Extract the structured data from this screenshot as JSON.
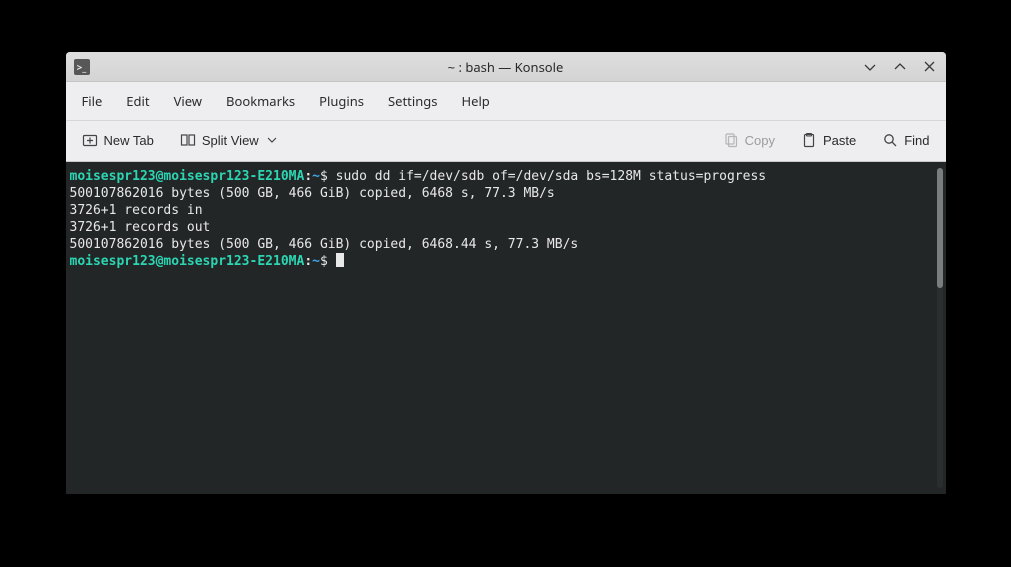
{
  "window": {
    "title": "~ : bash — Konsole"
  },
  "menu": {
    "file": "File",
    "edit": "Edit",
    "view": "View",
    "bookmarks": "Bookmarks",
    "plugins": "Plugins",
    "settings": "Settings",
    "help": "Help"
  },
  "toolbar": {
    "new_tab": "New Tab",
    "split_view": "Split View",
    "copy": "Copy",
    "paste": "Paste",
    "find": "Find"
  },
  "terminal": {
    "prompt_user_host": "moisespr123@moisespr123-E210MA",
    "prompt_sep": ":",
    "prompt_path": "~",
    "prompt_symbol": "$",
    "lines": {
      "cmd1": "sudo dd if=/dev/sdb of=/dev/sda bs=128M status=progress",
      "out1": "500107862016 bytes (500 GB, 466 GiB) copied, 6468 s, 77.3 MB/s",
      "out2": "3726+1 records in",
      "out3": "3726+1 records out",
      "out4": "500107862016 bytes (500 GB, 466 GiB) copied, 6468.44 s, 77.3 MB/s"
    }
  }
}
